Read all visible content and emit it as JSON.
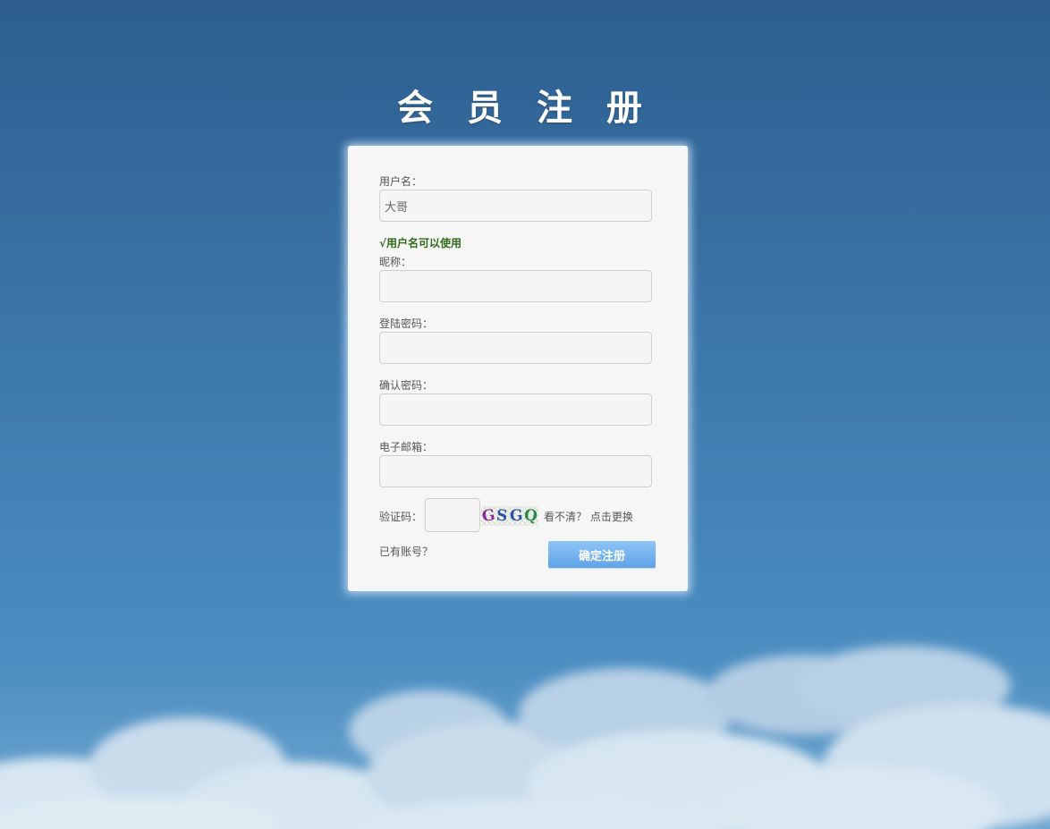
{
  "page": {
    "title": "会 员 注 册"
  },
  "form": {
    "username": {
      "label": "用户名：",
      "value": "大哥"
    },
    "username_status": "√用户名可以使用",
    "nickname": {
      "label": "昵称：",
      "value": ""
    },
    "password": {
      "label": "登陆密码：",
      "value": ""
    },
    "confirm_password": {
      "label": "确认密码：",
      "value": ""
    },
    "email": {
      "label": "电子邮箱：",
      "value": ""
    },
    "captcha": {
      "label": "验证码：",
      "value": "",
      "image_chars": [
        "G",
        "S",
        "G",
        "Q"
      ],
      "refresh_text": "看不清？ 点击更换"
    },
    "login_link": "已有账号？",
    "submit_label": "确定注册"
  },
  "colors": {
    "sky_top": "#2d5e8f",
    "sky_bottom": "#6ea5cf",
    "card_bg": "#f6f6f6",
    "success_text": "#2f6b17",
    "button_top": "#8ec4f5",
    "button_bottom": "#5ea3e8"
  }
}
